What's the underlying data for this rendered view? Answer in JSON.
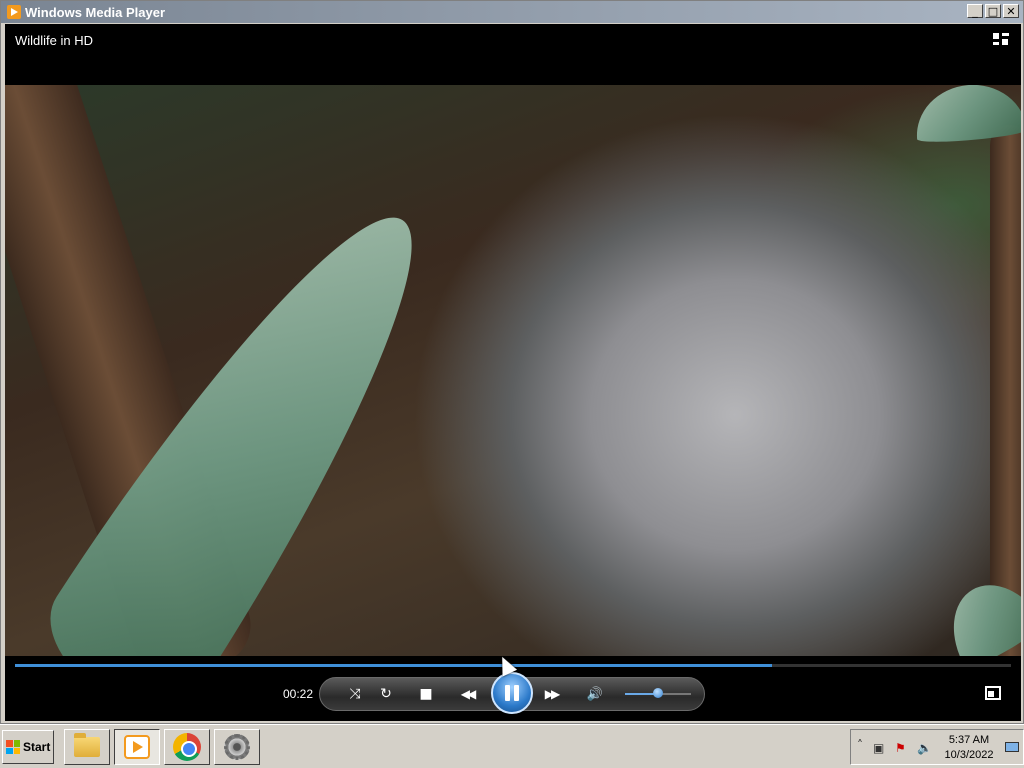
{
  "window": {
    "title": "Windows Media Player",
    "minimize_label": "_",
    "maximize_label": "□",
    "close_label": "✕"
  },
  "player": {
    "now_playing": "Wildlife in HD",
    "elapsed_time": "00:22",
    "seek_progress_fraction": 0.76,
    "volume_fraction": 0.5,
    "state": "playing",
    "controls": {
      "shuffle_icon": "⤨",
      "repeat_icon": "↻",
      "stop_icon": "■",
      "previous_icon": "◀◀",
      "next_icon": "▶▶",
      "mute_icon": "🔊"
    },
    "accent_color": "#3f8fd8"
  },
  "taskbar": {
    "start_label": "Start",
    "apps": [
      "file-explorer",
      "windows-media-player",
      "chrome",
      "settings"
    ],
    "tray": {
      "expand_icon": "˄",
      "time": "5:37 AM",
      "date": "10/3/2022"
    }
  }
}
